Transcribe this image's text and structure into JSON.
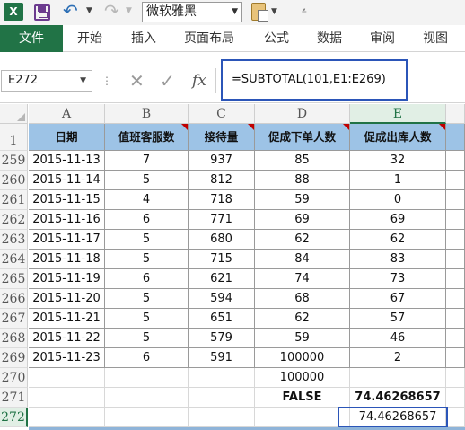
{
  "toolbar": {
    "app_logo": "X",
    "font_name": "微软雅黑",
    "icons": [
      "excel-logo-icon",
      "save-icon",
      "undo-icon",
      "redo-icon",
      "paste-icon"
    ]
  },
  "ribbon": {
    "file_tab": "文件",
    "tabs": [
      "开始",
      "插入",
      "页面布局",
      "公式",
      "数据",
      "审阅",
      "视图"
    ],
    "accent_color": "#217346"
  },
  "formula_bar": {
    "name_box": "E272",
    "fx_label": "fx",
    "formula": "=SUBTOTAL(101,E1:E269)"
  },
  "sheet": {
    "columns": [
      "A",
      "B",
      "C",
      "D",
      "E"
    ],
    "selected_column": "E",
    "header_row": {
      "row": "1",
      "cells": [
        "日期",
        "值班客服数",
        "接待量",
        "促成下单人数",
        "促成出库人数"
      ],
      "fill_color": "#9dc3e6"
    },
    "rows": [
      {
        "row": "259",
        "cells": [
          "2015-11-13",
          "7",
          "937",
          "85",
          "32"
        ]
      },
      {
        "row": "260",
        "cells": [
          "2015-11-14",
          "5",
          "812",
          "88",
          "1"
        ]
      },
      {
        "row": "261",
        "cells": [
          "2015-11-15",
          "4",
          "718",
          "59",
          "0"
        ]
      },
      {
        "row": "262",
        "cells": [
          "2015-11-16",
          "6",
          "771",
          "69",
          "69"
        ]
      },
      {
        "row": "263",
        "cells": [
          "2015-11-17",
          "5",
          "680",
          "62",
          "62"
        ]
      },
      {
        "row": "264",
        "cells": [
          "2015-11-18",
          "5",
          "715",
          "84",
          "83"
        ]
      },
      {
        "row": "265",
        "cells": [
          "2015-11-19",
          "6",
          "621",
          "74",
          "73"
        ]
      },
      {
        "row": "266",
        "cells": [
          "2015-11-20",
          "5",
          "594",
          "68",
          "67"
        ]
      },
      {
        "row": "267",
        "cells": [
          "2015-11-21",
          "5",
          "651",
          "62",
          "57"
        ]
      },
      {
        "row": "268",
        "cells": [
          "2015-11-22",
          "5",
          "579",
          "59",
          "46"
        ]
      },
      {
        "row": "269",
        "cells": [
          "2015-11-23",
          "6",
          "591",
          "100000",
          "2"
        ]
      },
      {
        "row": "270",
        "cells": [
          "",
          "",
          "",
          "100000",
          ""
        ]
      },
      {
        "row": "271",
        "cells": [
          "",
          "",
          "",
          "FALSE",
          "74.46268657"
        ]
      },
      {
        "row": "272",
        "cells": [
          "",
          "",
          "",
          "",
          "74.46268657"
        ]
      }
    ],
    "selected_cell": "E272"
  }
}
